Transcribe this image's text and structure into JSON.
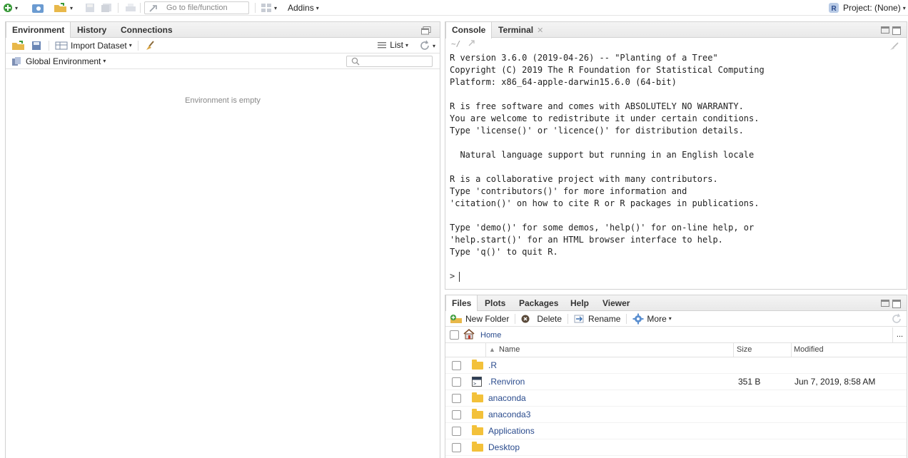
{
  "toolbar": {
    "goto_placeholder": "Go to file/function",
    "addins_label": "Addins",
    "project_label": "Project: (None)"
  },
  "env_pane": {
    "tabs": [
      "Environment",
      "History",
      "Connections"
    ],
    "import_dataset_label": "Import Dataset",
    "list_label": "List",
    "global_env_label": "Global Environment",
    "empty_message": "Environment is empty"
  },
  "console_pane": {
    "tabs": [
      "Console",
      "Terminal"
    ],
    "path": "~/",
    "output": "R version 3.6.0 (2019-04-26) -- \"Planting of a Tree\"\nCopyright (C) 2019 The R Foundation for Statistical Computing\nPlatform: x86_64-apple-darwin15.6.0 (64-bit)\n\nR is free software and comes with ABSOLUTELY NO WARRANTY.\nYou are welcome to redistribute it under certain conditions.\nType 'license()' or 'licence()' for distribution details.\n\n  Natural language support but running in an English locale\n\nR is a collaborative project with many contributors.\nType 'contributors()' for more information and\n'citation()' on how to cite R or R packages in publications.\n\nType 'demo()' for some demos, 'help()' for on-line help, or\n'help.start()' for an HTML browser interface to help.\nType 'q()' to quit R.",
    "prompt": ">"
  },
  "files_pane": {
    "tabs": [
      "Files",
      "Plots",
      "Packages",
      "Help",
      "Viewer"
    ],
    "new_folder_label": "New Folder",
    "delete_label": "Delete",
    "rename_label": "Rename",
    "more_label": "More",
    "breadcrumb": "Home",
    "more_path": "...",
    "columns": {
      "name": "Name",
      "size": "Size",
      "modified": "Modified"
    },
    "rows": [
      {
        "name": ".R",
        "type": "folder",
        "size": "",
        "modified": ""
      },
      {
        "name": ".Renviron",
        "type": "file",
        "size": "351 B",
        "modified": "Jun 7, 2019, 8:58 AM"
      },
      {
        "name": "anaconda",
        "type": "folder",
        "size": "",
        "modified": ""
      },
      {
        "name": "anaconda3",
        "type": "folder",
        "size": "",
        "modified": ""
      },
      {
        "name": "Applications",
        "type": "folder",
        "size": "",
        "modified": ""
      },
      {
        "name": "Desktop",
        "type": "folder",
        "size": "",
        "modified": ""
      }
    ]
  },
  "colors": {
    "link": "#2a4b8d",
    "folder": "#f3c13a",
    "accent_green": "#3a9a3a"
  }
}
